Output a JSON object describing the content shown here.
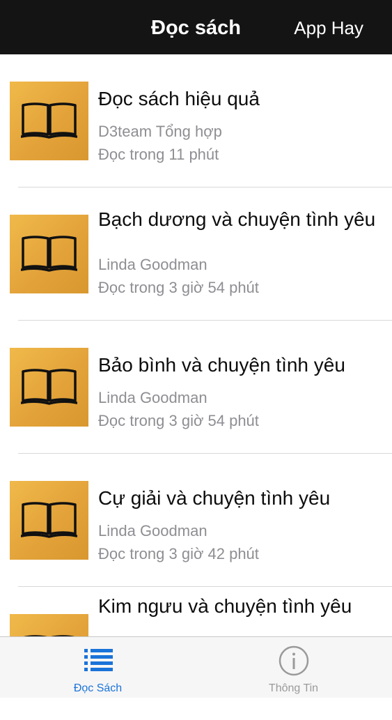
{
  "navbar": {
    "title": "Đọc sách",
    "right_label": "App Hay"
  },
  "books": [
    {
      "title": "Đọc sách hiệu quả",
      "author": "D3team Tổng hợp",
      "read_time": "Đọc trong 11 phút",
      "icon": "book-icon"
    },
    {
      "title": "Bạch dương và chuyện tình yêu",
      "author": "Linda Goodman",
      "read_time": "Đọc trong 3 giờ 54 phút",
      "icon": "book-icon"
    },
    {
      "title": "Bảo bình và chuyện tình yêu",
      "author": "Linda Goodman",
      "read_time": "Đọc trong 3 giờ 54 phút",
      "icon": "book-icon"
    },
    {
      "title": "Cự giải và chuyện tình yêu",
      "author": "Linda Goodman",
      "read_time": "Đọc trong 3 giờ 42 phút",
      "icon": "book-icon"
    },
    {
      "title": "Kim ngưu và chuyện tình yêu",
      "author": "",
      "read_time": "",
      "icon": "book-icon"
    }
  ],
  "tabbar": {
    "tabs": [
      {
        "label": "Đọc Sách",
        "icon": "list-icon",
        "active": true
      },
      {
        "label": "Thông Tin",
        "icon": "info-icon",
        "active": false
      }
    ]
  },
  "colors": {
    "navbar_bg": "#141414",
    "accent": "#1a73d9",
    "thumb_gold": "#e3a33a",
    "secondary_text": "#8e8e93"
  }
}
